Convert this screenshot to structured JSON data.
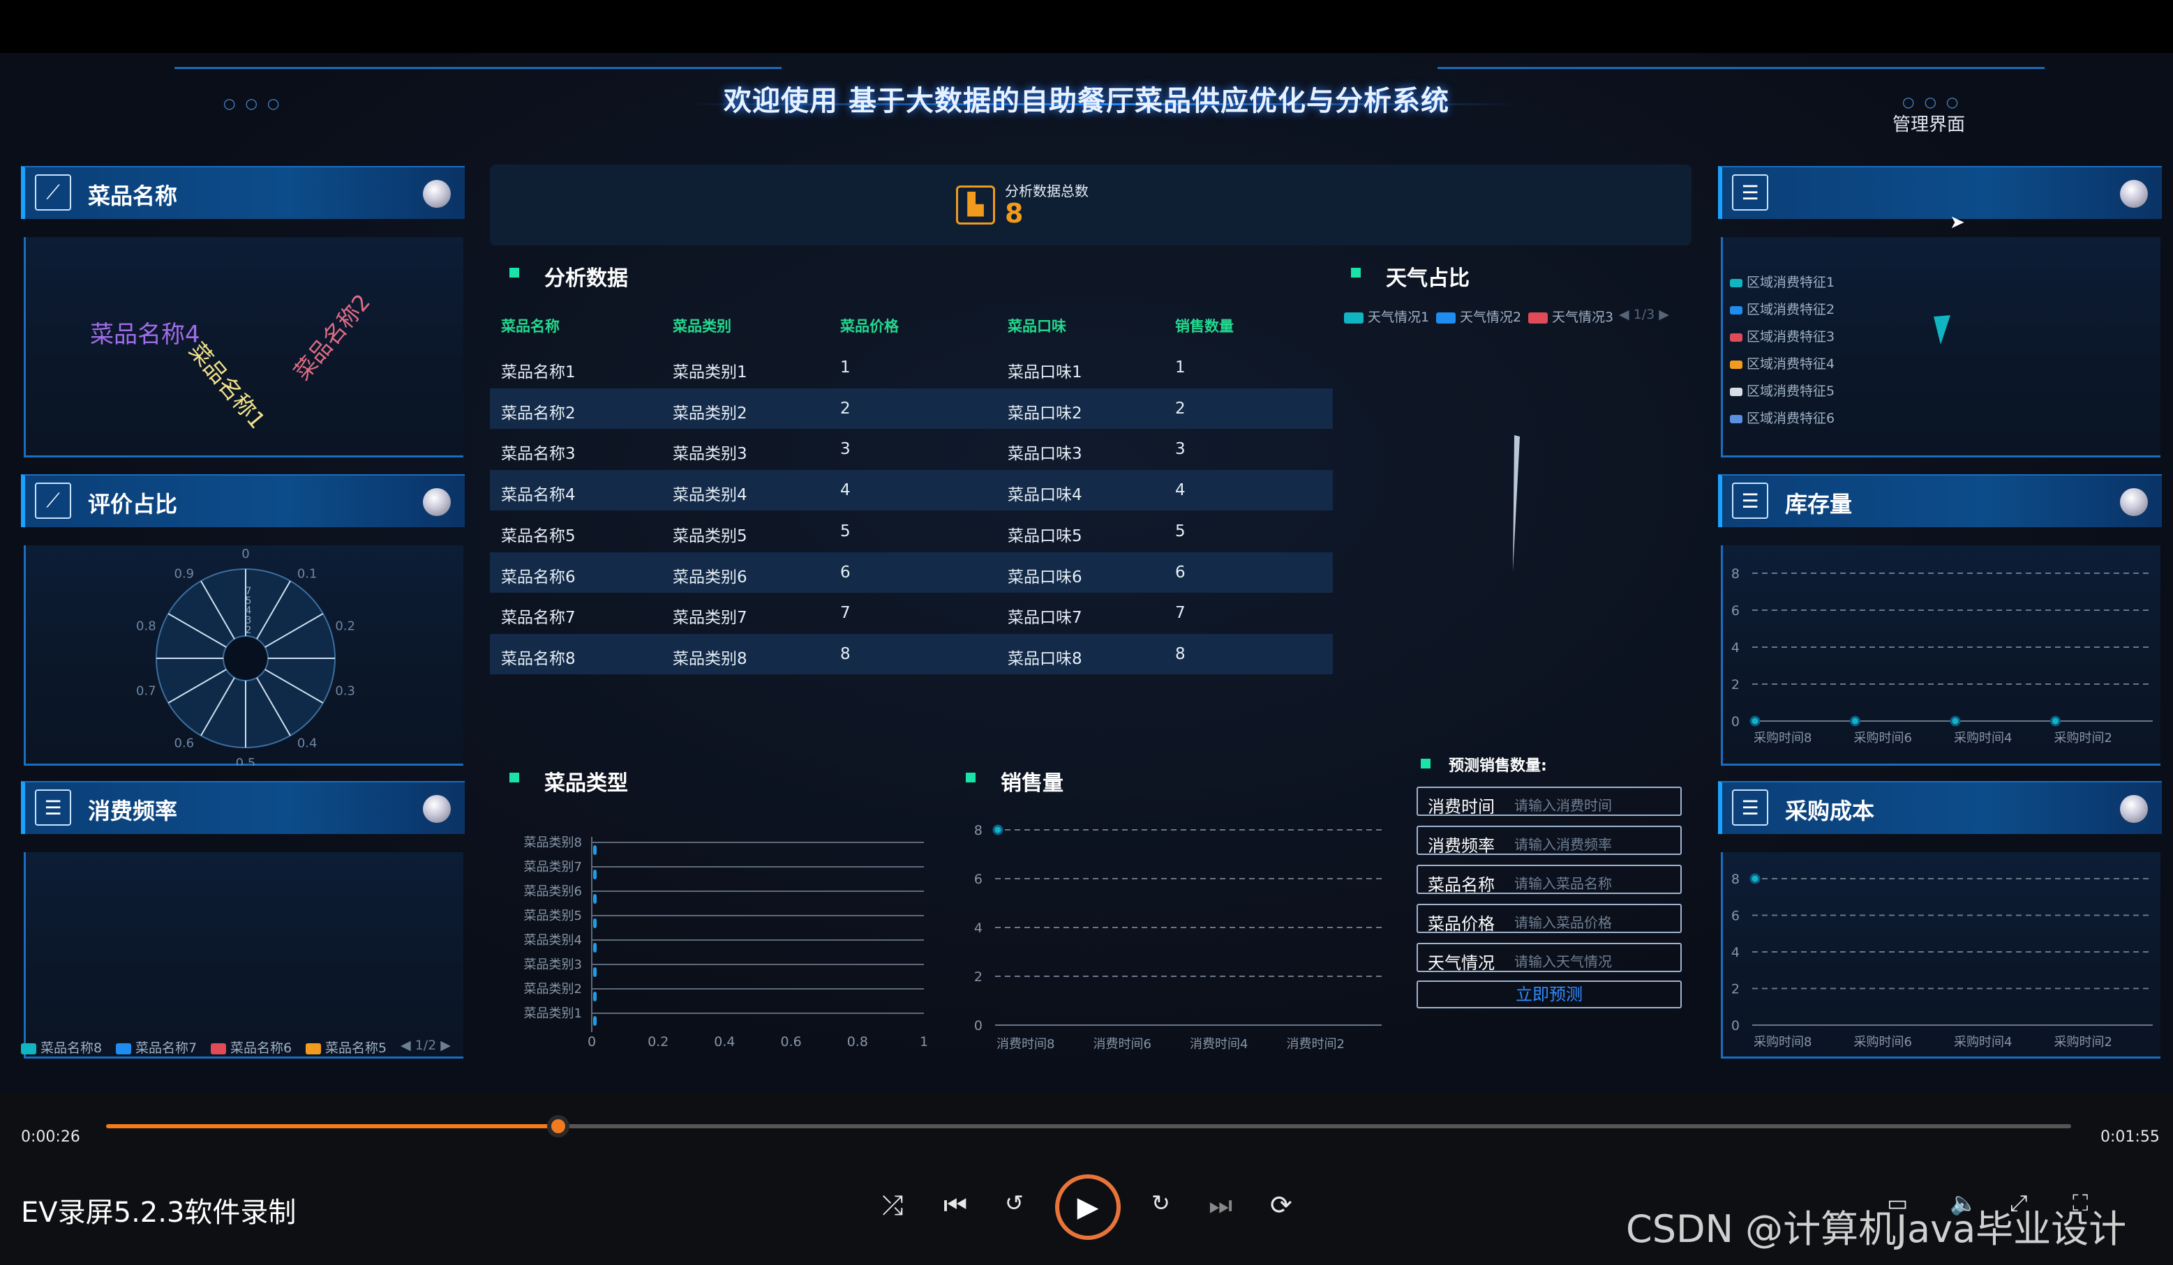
{
  "app_title": "欢迎使用 基于大数据的自助餐厅菜品供应优化与分析系统",
  "admin_label": "管理界面",
  "total": {
    "label": "分析数据总数",
    "value": "8"
  },
  "panels": {
    "dish_name": {
      "title": "菜品名称",
      "words": [
        "菜品名称4",
        "菜品名称1",
        "菜品名称2"
      ]
    },
    "rating_ratio": {
      "title": "评价占比",
      "ticks": [
        "0",
        "0.1",
        "0.2",
        "0.3",
        "0.4",
        "0.5",
        "0.6",
        "0.7",
        "0.8",
        "0.9"
      ],
      "inner": [
        "2",
        "3",
        "4",
        "5",
        "7"
      ]
    },
    "consume_freq": {
      "title": "消费频率",
      "legend": [
        "菜品名称8",
        "菜品名称7",
        "菜品名称6",
        "菜品名称5"
      ],
      "pager": "1/2"
    },
    "region": {
      "legend": [
        "区域消费特征1",
        "区域消费特征2",
        "区域消费特征3",
        "区域消费特征4",
        "区域消费特征5",
        "区域消费特征6"
      ]
    },
    "stock": {
      "title": "库存量"
    },
    "purchase_cost": {
      "title": "采购成本"
    }
  },
  "analysis": {
    "title": "分析数据",
    "headers": [
      "菜品名称",
      "菜品类别",
      "菜品价格",
      "菜品口味",
      "销售数量"
    ],
    "rows": [
      [
        "菜品名称1",
        "菜品类别1",
        "1",
        "菜品口味1",
        "1"
      ],
      [
        "菜品名称2",
        "菜品类别2",
        "2",
        "菜品口味2",
        "2"
      ],
      [
        "菜品名称3",
        "菜品类别3",
        "3",
        "菜品口味3",
        "3"
      ],
      [
        "菜品名称4",
        "菜品类别4",
        "4",
        "菜品口味4",
        "4"
      ],
      [
        "菜品名称5",
        "菜品类别5",
        "5",
        "菜品口味5",
        "5"
      ],
      [
        "菜品名称6",
        "菜品类别6",
        "6",
        "菜品口味6",
        "6"
      ],
      [
        "菜品名称7",
        "菜品类别7",
        "7",
        "菜品口味7",
        "7"
      ],
      [
        "菜品名称8",
        "菜品类别8",
        "8",
        "菜品口味8",
        "8"
      ]
    ]
  },
  "weather": {
    "title": "天气占比",
    "legend": [
      "天气情况1",
      "天气情况2",
      "天气情况3"
    ],
    "pager": "1/3"
  },
  "dish_type": {
    "title": "菜品类型"
  },
  "sales": {
    "title": "销售量"
  },
  "predict": {
    "title": "预测销售数量:",
    "fields": [
      {
        "label": "消费时间",
        "placeholder": "请输入消费时间"
      },
      {
        "label": "消费频率",
        "placeholder": "请输入消费频率"
      },
      {
        "label": "菜品名称",
        "placeholder": "请输入菜品名称"
      },
      {
        "label": "菜品价格",
        "placeholder": "请输入菜品价格"
      },
      {
        "label": "天气情况",
        "placeholder": "请输入天气情况"
      }
    ],
    "button": "立即预测"
  },
  "chart_data": [
    {
      "type": "bar",
      "title": "菜品类型",
      "categories": [
        "菜品类别8",
        "菜品类别7",
        "菜品类别6",
        "菜品类别5",
        "菜品类别4",
        "菜品类别3",
        "菜品类别2",
        "菜品类别1"
      ],
      "values": [
        0,
        0,
        0,
        0,
        0,
        0,
        0,
        0
      ],
      "xlim": [
        0,
        1
      ],
      "xticks": [
        "0",
        "0.2",
        "0.4",
        "0.6",
        "0.8",
        "1"
      ],
      "orientation": "horizontal"
    },
    {
      "type": "line",
      "title": "销售量",
      "categories": [
        "消费时间8",
        "消费时间6",
        "消费时间4",
        "消费时间2"
      ],
      "values": [
        8
      ],
      "ylim": [
        0,
        8
      ],
      "yticks": [
        "0",
        "2",
        "4",
        "6",
        "8"
      ]
    },
    {
      "type": "line",
      "title": "库存量",
      "categories": [
        "采购时间8",
        "采购时间6",
        "采购时间4",
        "采购时间2"
      ],
      "values": [
        0,
        0,
        0,
        0
      ],
      "ylim": [
        0,
        8
      ],
      "yticks": [
        "0",
        "2",
        "4",
        "6",
        "8"
      ]
    },
    {
      "type": "line",
      "title": "采购成本",
      "categories": [
        "采购时间8",
        "采购时间6",
        "采购时间4",
        "采购时间2"
      ],
      "values": [
        8
      ],
      "ylim": [
        0,
        8
      ],
      "yticks": [
        "0",
        "2",
        "4",
        "6",
        "8"
      ]
    }
  ],
  "player": {
    "elapsed": "0:00:26",
    "duration": "0:01:55",
    "progress": 0.23,
    "app_name": "EV录屏5.2.3软件录制",
    "watermark": "CSDN @计算机Java毕业设计"
  }
}
